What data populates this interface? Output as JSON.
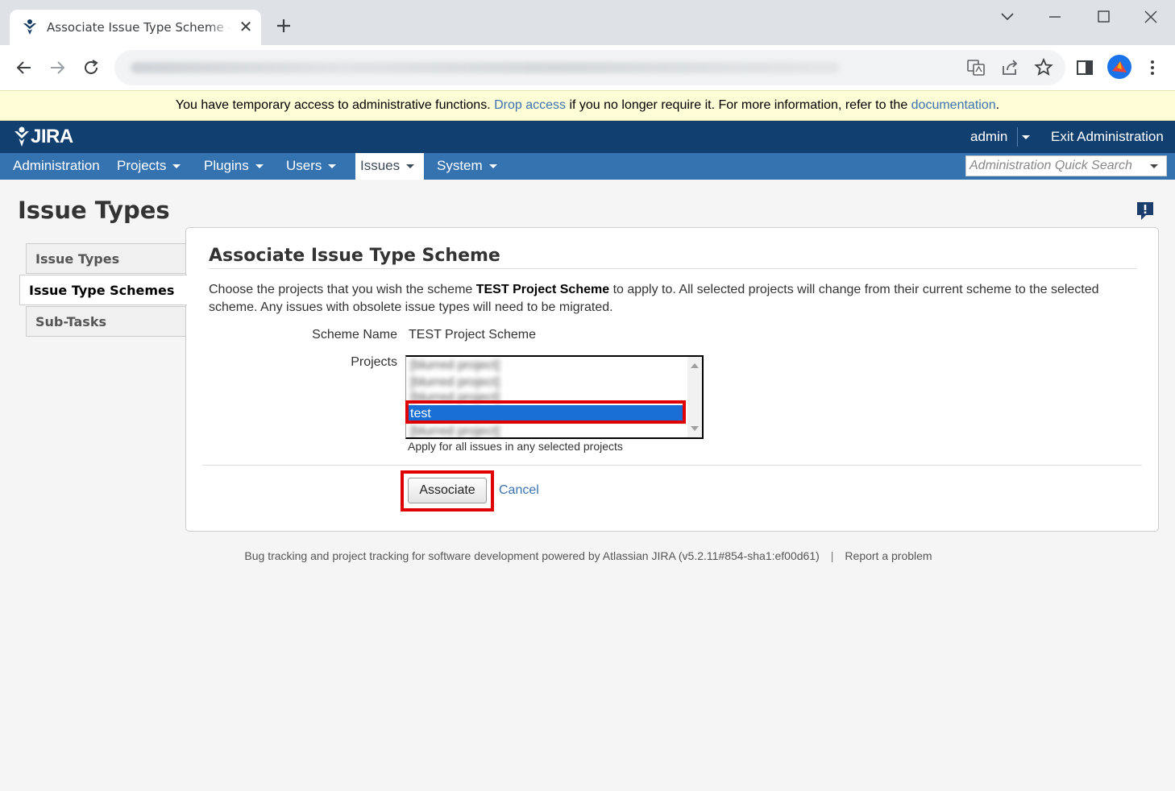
{
  "browser": {
    "tab_title": "Associate Issue Type Scheme - Sym",
    "close_glyph": "✕",
    "new_tab_glyph": "+"
  },
  "banner": {
    "text_before": "You have temporary access to administrative functions. ",
    "drop_access": "Drop access",
    "text_middle": " if you no longer require it. For more information, refer to the ",
    "documentation": "documentation",
    "text_after": "."
  },
  "header": {
    "logo": "JIRA",
    "user": "admin",
    "exit": "Exit Administration"
  },
  "nav": {
    "items": [
      {
        "label": "Administration"
      },
      {
        "label": "Projects"
      },
      {
        "label": "Plugins"
      },
      {
        "label": "Users"
      },
      {
        "label": "Issues"
      },
      {
        "label": "System"
      }
    ],
    "quick_search_placeholder": "Administration Quick Search"
  },
  "page": {
    "title": "Issue Types",
    "side_menu": [
      {
        "label": "Issue Types"
      },
      {
        "label": "Issue Type Schemes"
      },
      {
        "label": "Sub-Tasks"
      }
    ]
  },
  "form": {
    "title": "Associate Issue Type Scheme",
    "desc_before": "Choose the projects that you wish the scheme ",
    "desc_scheme": "TEST Project Scheme",
    "desc_after": " to apply to. All selected projects will change from their current scheme to the selected scheme. Any issues with obsolete issue types will need to be migrated.",
    "scheme_name_label": "Scheme Name",
    "scheme_name_value": "TEST Project Scheme",
    "projects_label": "Projects",
    "projects": [
      {
        "label": "[blurred project]",
        "blurred": true
      },
      {
        "label": "[blurred project]",
        "blurred": true
      },
      {
        "label": "[blurred project]",
        "blurred": true
      },
      {
        "label": "test",
        "blurred": false,
        "selected": true
      },
      {
        "label": "[blurred project]",
        "blurred": true
      }
    ],
    "help_text": "Apply for all issues in any selected projects",
    "associate_label": "Associate",
    "cancel_label": "Cancel"
  },
  "footer": {
    "text": "Bug tracking and project tracking for software development powered by Atlassian JIRA (v5.2.11#854-sha1:ef00d61)",
    "separator": "|",
    "report": "Report a problem"
  },
  "colors": {
    "header_bg": "#114070",
    "nav_bg": "#3572b0",
    "link": "#3b73af",
    "banner_bg": "#fffdd6",
    "selected_row": "#1a6fd6",
    "highlight": "#e00000"
  }
}
